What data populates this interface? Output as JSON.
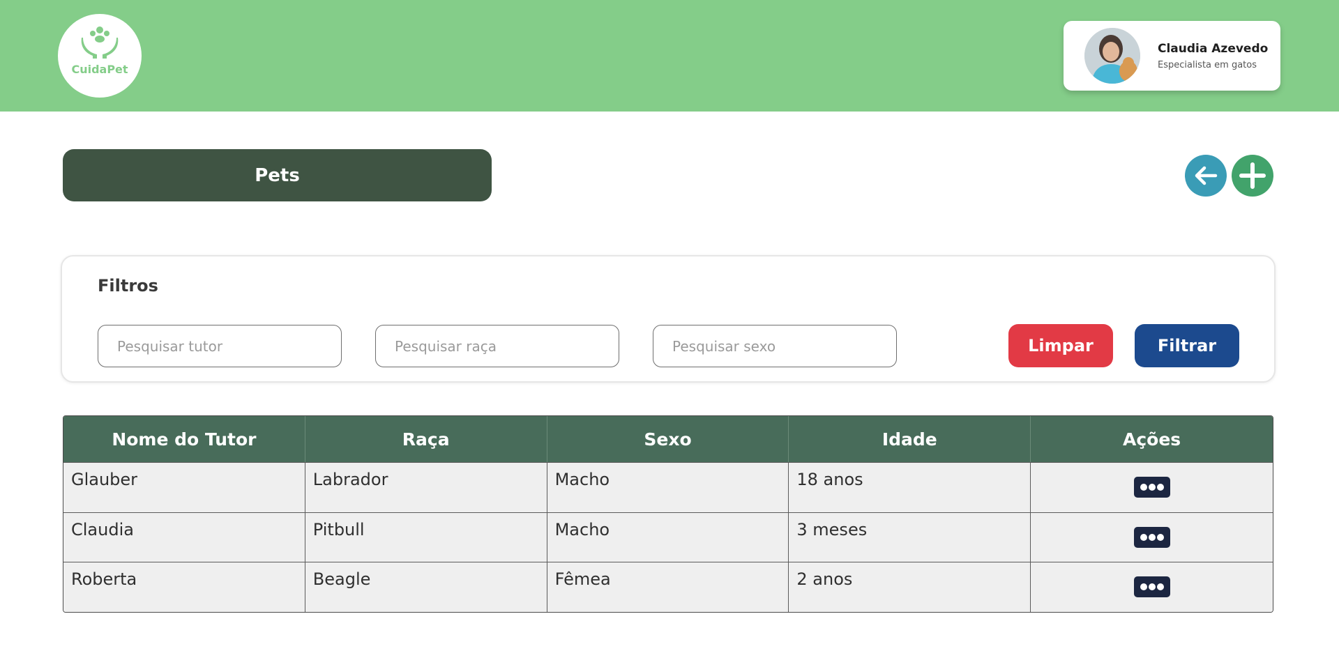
{
  "colors": {
    "header_bg": "#84cd89",
    "title_bar_bg": "#3f5443",
    "back_button": "#3a9cb6",
    "add_button": "#42a36b",
    "clear_button": "#e23a45",
    "filter_button": "#1c4a8e",
    "table_header_bg": "#486c5a",
    "row_bg": "#efefef",
    "action_button": "#1c2641"
  },
  "header": {
    "logo_text": "CuidaPet",
    "logo_icon": "paw-hands-icon",
    "profile": {
      "name": "Claudia Azevedo",
      "role": "Especialista em gatos",
      "avatar": "user-avatar-photo"
    }
  },
  "page": {
    "title": "Pets",
    "back_icon": "arrow-left-icon",
    "add_icon": "plus-icon"
  },
  "filters": {
    "title": "Filtros",
    "tutor_placeholder": "Pesquisar tutor",
    "breed_placeholder": "Pesquisar raça",
    "sex_placeholder": "Pesquisar sexo",
    "clear_label": "Limpar",
    "filter_label": "Filtrar"
  },
  "table": {
    "headers": [
      "Nome do Tutor",
      "Raça",
      "Sexo",
      "Idade",
      "Ações"
    ],
    "rows": [
      {
        "tutor": "Glauber",
        "breed": "Labrador",
        "sex": "Macho",
        "age": "18 anos"
      },
      {
        "tutor": "Claudia",
        "breed": "Pitbull",
        "sex": "Macho",
        "age": "3 meses"
      },
      {
        "tutor": "Roberta",
        "breed": "Beagle",
        "sex": "Fêmea",
        "age": "2 anos"
      }
    ],
    "action_icon": "more-dots-icon"
  }
}
